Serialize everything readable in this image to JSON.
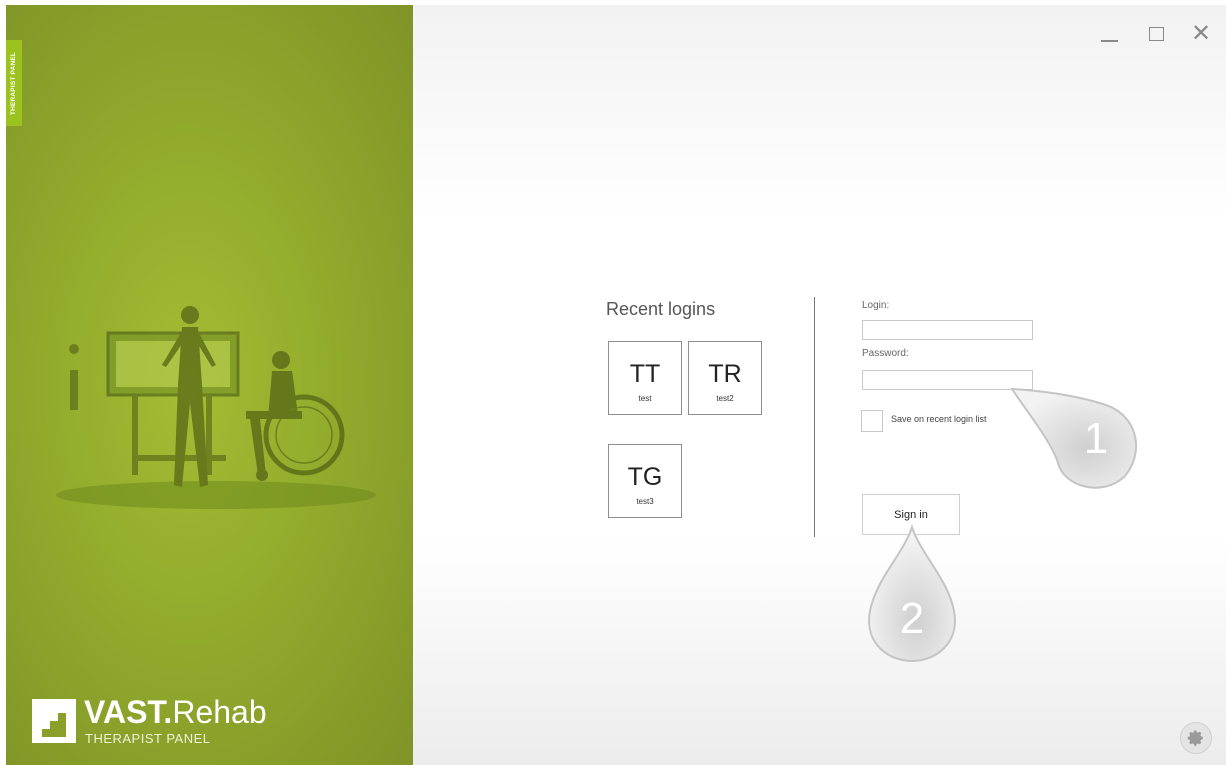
{
  "sidebar": {
    "vertical_tab": "THERAPIST PANEL",
    "logo": {
      "brand_bold": "VAST.",
      "brand_regular": "Rehab",
      "subtitle": "THERAPIST PANEL"
    }
  },
  "window_controls": {
    "close_glyph": "✕"
  },
  "recent": {
    "title": "Recent logins",
    "users": [
      {
        "initials": "TT",
        "name": "test"
      },
      {
        "initials": "TR",
        "name": "test2"
      },
      {
        "initials": "TG",
        "name": "test3"
      }
    ]
  },
  "form": {
    "login_label": "Login:",
    "login_value": "",
    "password_label": "Password:",
    "password_value": "",
    "remember_label": "Save on recent login list",
    "remember_checked": false,
    "signin_label": "Sign in"
  },
  "callouts": [
    {
      "number": "1"
    },
    {
      "number": "2"
    }
  ],
  "icons": {
    "minimize": "minimize-icon",
    "maximize": "maximize-icon",
    "close": "close-icon",
    "settings": "gear-icon"
  },
  "colors": {
    "brand_green": "#93ad2d",
    "tab_green": "#9cc21e"
  }
}
